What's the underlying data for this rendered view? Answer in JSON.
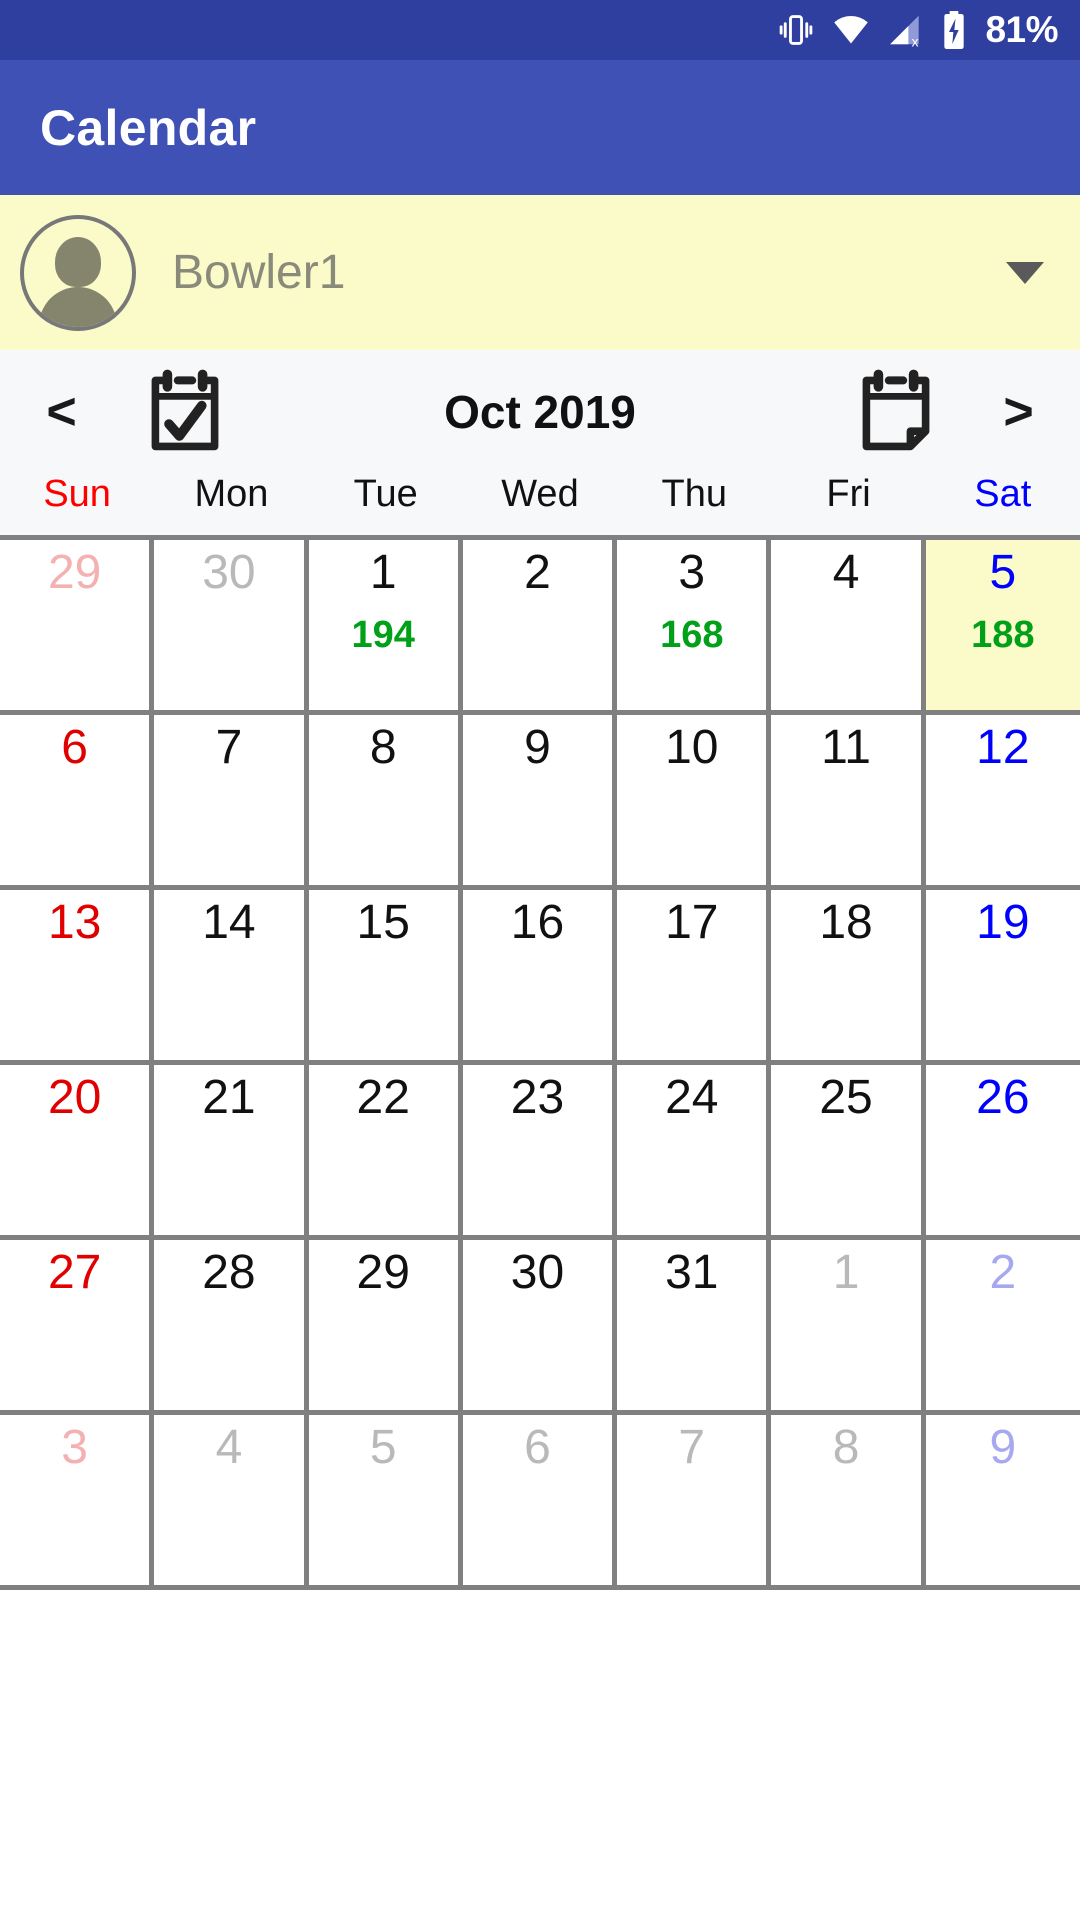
{
  "status_bar": {
    "battery_percent": "81%",
    "icons": [
      "vibrate-icon",
      "wifi-icon",
      "cellular-signal-off-icon",
      "battery-charging-icon"
    ],
    "background": "#2f3fa0"
  },
  "app_bar": {
    "title": "Calendar",
    "background": "#3f51b5"
  },
  "user_band": {
    "user_name": "Bowler1",
    "background": "#fafbc9",
    "dropdown_icon": "chevron-down-icon"
  },
  "month_nav": {
    "prev_label": "<",
    "next_label": ">",
    "month_label": "Oct 2019",
    "left_icon": "calendar-check-icon",
    "right_icon": "calendar-page-icon"
  },
  "weekdays": [
    {
      "label": "Sun",
      "color": "#ff0000"
    },
    {
      "label": "Mon",
      "color": "#111111"
    },
    {
      "label": "Tue",
      "color": "#111111"
    },
    {
      "label": "Wed",
      "color": "#111111"
    },
    {
      "label": "Thu",
      "color": "#111111"
    },
    {
      "label": "Fri",
      "color": "#111111"
    },
    {
      "label": "Sat",
      "color": "#0000ff"
    }
  ],
  "colors": {
    "score_green": "#00a018",
    "highlight_yellow": "#fafbc9",
    "grid_line": "#808080"
  },
  "calendar": {
    "month": "Oct",
    "year": "2019",
    "weeks": [
      [
        {
          "day": "29",
          "out_of_month": true,
          "weekday": "sun",
          "score": "",
          "highlight": false
        },
        {
          "day": "30",
          "out_of_month": true,
          "weekday": "mon",
          "score": "",
          "highlight": false
        },
        {
          "day": "1",
          "out_of_month": false,
          "weekday": "tue",
          "score": "194",
          "highlight": false
        },
        {
          "day": "2",
          "out_of_month": false,
          "weekday": "wed",
          "score": "",
          "highlight": false
        },
        {
          "day": "3",
          "out_of_month": false,
          "weekday": "thu",
          "score": "168",
          "highlight": false
        },
        {
          "day": "4",
          "out_of_month": false,
          "weekday": "fri",
          "score": "",
          "highlight": false
        },
        {
          "day": "5",
          "out_of_month": false,
          "weekday": "sat",
          "score": "188",
          "highlight": true
        }
      ],
      [
        {
          "day": "6",
          "out_of_month": false,
          "weekday": "sun",
          "score": "",
          "highlight": false
        },
        {
          "day": "7",
          "out_of_month": false,
          "weekday": "mon",
          "score": "",
          "highlight": false
        },
        {
          "day": "8",
          "out_of_month": false,
          "weekday": "tue",
          "score": "",
          "highlight": false
        },
        {
          "day": "9",
          "out_of_month": false,
          "weekday": "wed",
          "score": "",
          "highlight": false
        },
        {
          "day": "10",
          "out_of_month": false,
          "weekday": "thu",
          "score": "",
          "highlight": false
        },
        {
          "day": "11",
          "out_of_month": false,
          "weekday": "fri",
          "score": "",
          "highlight": false
        },
        {
          "day": "12",
          "out_of_month": false,
          "weekday": "sat",
          "score": "",
          "highlight": false
        }
      ],
      [
        {
          "day": "13",
          "out_of_month": false,
          "weekday": "sun",
          "score": "",
          "highlight": false
        },
        {
          "day": "14",
          "out_of_month": false,
          "weekday": "mon",
          "score": "",
          "highlight": false
        },
        {
          "day": "15",
          "out_of_month": false,
          "weekday": "tue",
          "score": "",
          "highlight": false
        },
        {
          "day": "16",
          "out_of_month": false,
          "weekday": "wed",
          "score": "",
          "highlight": false
        },
        {
          "day": "17",
          "out_of_month": false,
          "weekday": "thu",
          "score": "",
          "highlight": false
        },
        {
          "day": "18",
          "out_of_month": false,
          "weekday": "fri",
          "score": "",
          "highlight": false
        },
        {
          "day": "19",
          "out_of_month": false,
          "weekday": "sat",
          "score": "",
          "highlight": false
        }
      ],
      [
        {
          "day": "20",
          "out_of_month": false,
          "weekday": "sun",
          "score": "",
          "highlight": false
        },
        {
          "day": "21",
          "out_of_month": false,
          "weekday": "mon",
          "score": "",
          "highlight": false
        },
        {
          "day": "22",
          "out_of_month": false,
          "weekday": "tue",
          "score": "",
          "highlight": false
        },
        {
          "day": "23",
          "out_of_month": false,
          "weekday": "wed",
          "score": "",
          "highlight": false
        },
        {
          "day": "24",
          "out_of_month": false,
          "weekday": "thu",
          "score": "",
          "highlight": false
        },
        {
          "day": "25",
          "out_of_month": false,
          "weekday": "fri",
          "score": "",
          "highlight": false
        },
        {
          "day": "26",
          "out_of_month": false,
          "weekday": "sat",
          "score": "",
          "highlight": false
        }
      ],
      [
        {
          "day": "27",
          "out_of_month": false,
          "weekday": "sun",
          "score": "",
          "highlight": false
        },
        {
          "day": "28",
          "out_of_month": false,
          "weekday": "mon",
          "score": "",
          "highlight": false
        },
        {
          "day": "29",
          "out_of_month": false,
          "weekday": "tue",
          "score": "",
          "highlight": false
        },
        {
          "day": "30",
          "out_of_month": false,
          "weekday": "wed",
          "score": "",
          "highlight": false
        },
        {
          "day": "31",
          "out_of_month": false,
          "weekday": "thu",
          "score": "",
          "highlight": false
        },
        {
          "day": "1",
          "out_of_month": true,
          "weekday": "fri",
          "score": "",
          "highlight": false
        },
        {
          "day": "2",
          "out_of_month": true,
          "weekday": "sat",
          "score": "",
          "highlight": false
        }
      ],
      [
        {
          "day": "3",
          "out_of_month": true,
          "weekday": "sun",
          "score": "",
          "highlight": false
        },
        {
          "day": "4",
          "out_of_month": true,
          "weekday": "mon",
          "score": "",
          "highlight": false
        },
        {
          "day": "5",
          "out_of_month": true,
          "weekday": "tue",
          "score": "",
          "highlight": false
        },
        {
          "day": "6",
          "out_of_month": true,
          "weekday": "wed",
          "score": "",
          "highlight": false
        },
        {
          "day": "7",
          "out_of_month": true,
          "weekday": "thu",
          "score": "",
          "highlight": false
        },
        {
          "day": "8",
          "out_of_month": true,
          "weekday": "fri",
          "score": "",
          "highlight": false
        },
        {
          "day": "9",
          "out_of_month": true,
          "weekday": "sat",
          "score": "",
          "highlight": false
        }
      ]
    ]
  }
}
